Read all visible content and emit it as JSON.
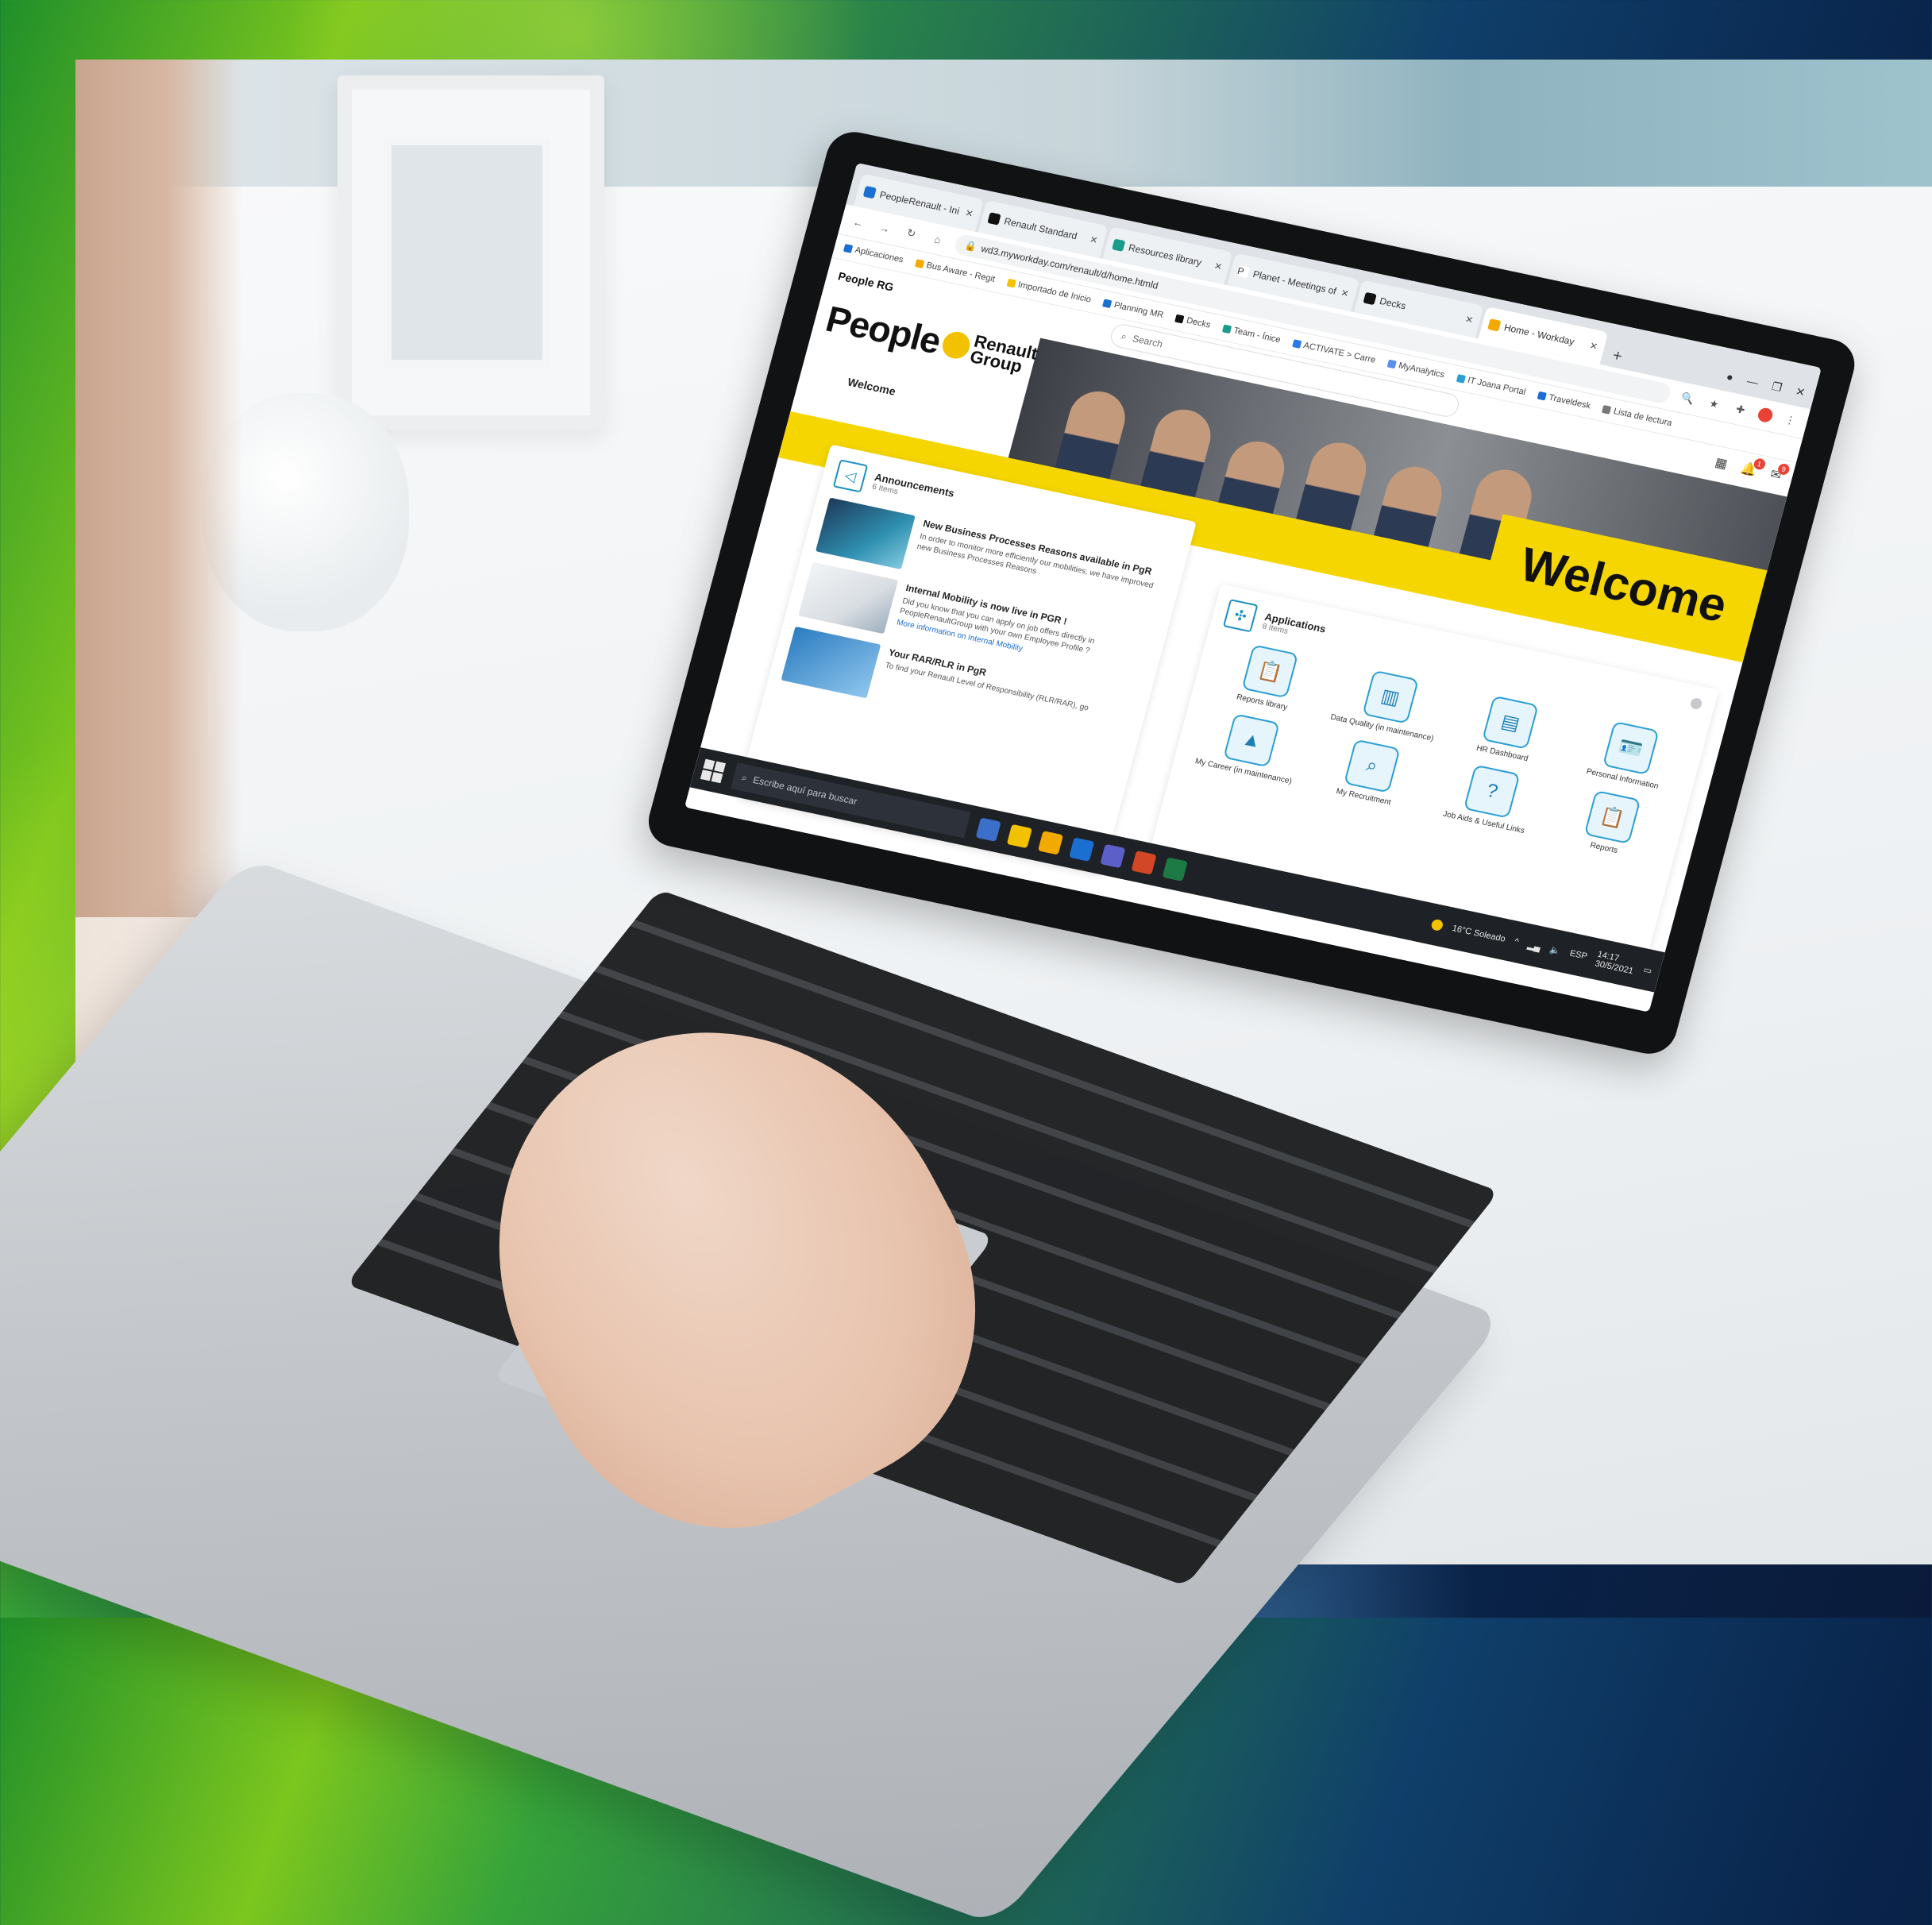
{
  "browser": {
    "tabs": [
      {
        "label": "PeopleRenault - Ini"
      },
      {
        "label": "Renault Standard"
      },
      {
        "label": "Resources library"
      },
      {
        "label": "Planet - Meetings of"
      },
      {
        "label": "Decks"
      },
      {
        "label": "Home - Workday",
        "active": true
      }
    ],
    "new_tab": "+",
    "url": "wd3.myworkday.com/renault/d/home.htmld",
    "bookmarks": [
      "Aplicaciones",
      "Bus Aware - Regit",
      "Importado de Inicio",
      "Planning MR",
      "Decks",
      "Team - Ínice",
      "ACTIVATE > Carre",
      "MyAnalytics",
      "IT Joana Portal",
      "Traveldesk",
      "Lista de lectura"
    ]
  },
  "app": {
    "mini_logo": "People RG",
    "search_placeholder": "Search",
    "notifications_count": "1",
    "inbox_count": "9",
    "brand": {
      "word": "People",
      "renault": "Renault",
      "group": "Group"
    },
    "welcome_nav": "Welcome",
    "welcome_banner": "Welcome",
    "announcements": {
      "title": "Announcements",
      "subtitle": "6 Items",
      "items": [
        {
          "title": "New Business Processes Reasons available in PgR",
          "body": "In order to monitor more efficiently our mobilities, we have improved new Business Processes Reasons",
          "link": ""
        },
        {
          "title": "Internal Mobility is now live in PGR !",
          "body": "Did you know that you can apply on job offers directly in PeopleRenaultGroup with your own Employee Profile ?",
          "link": "More information on Internal Mobility"
        },
        {
          "title": "Your RAR/RLR in PgR",
          "body": "To find your Renault Level of Responsibility (RLR/RAR), go",
          "link": ""
        }
      ]
    },
    "applications": {
      "title": "Applications",
      "subtitle": "8 Items",
      "tiles": [
        {
          "label": "Reports library",
          "icon": "clipboard-icon"
        },
        {
          "label": "Data Quality (in maintenance)",
          "icon": "chart-icon"
        },
        {
          "label": "HR Dashboard",
          "icon": "dashboard-icon"
        },
        {
          "label": "Personal Information",
          "icon": "id-card-icon"
        },
        {
          "label": "My Career (in maintenance)",
          "icon": "mountain-icon"
        },
        {
          "label": "My Recruitment",
          "icon": "magnifier-icon"
        },
        {
          "label": "Job Aids & Useful Links",
          "icon": "question-icon"
        },
        {
          "label": "Reports",
          "icon": "clipboard-icon"
        }
      ]
    }
  },
  "taskbar": {
    "search_placeholder": "Escribe aquí para buscar",
    "weather": "16°C Soleado",
    "language": "ESP",
    "time": "14:17",
    "date": "30/5/2021"
  },
  "colors": {
    "brand_yellow": "#f6d600",
    "accent_blue": "#1b8fc0"
  }
}
